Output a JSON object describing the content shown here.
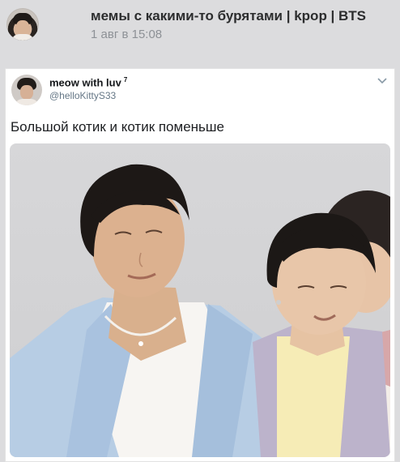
{
  "post": {
    "group_name": "мемы с какими-то бурятами | kpop | BTS",
    "date": "1 авг в 15:08",
    "group_avatar_icon": "group-avatar-photo"
  },
  "tweet": {
    "display_name": "meow with luv",
    "name_superscript": "7",
    "handle": "@helloKittyS33",
    "text": "Большой котик и котик поменьше",
    "menu_icon": "chevron-down-icon",
    "photo_icon": "tweet-photo"
  },
  "colors": {
    "background": "#dcdcde",
    "title_text": "#2c2d2e",
    "secondary_text": "#8d9196",
    "card": "#ffffff",
    "handle_text": "#657786"
  }
}
